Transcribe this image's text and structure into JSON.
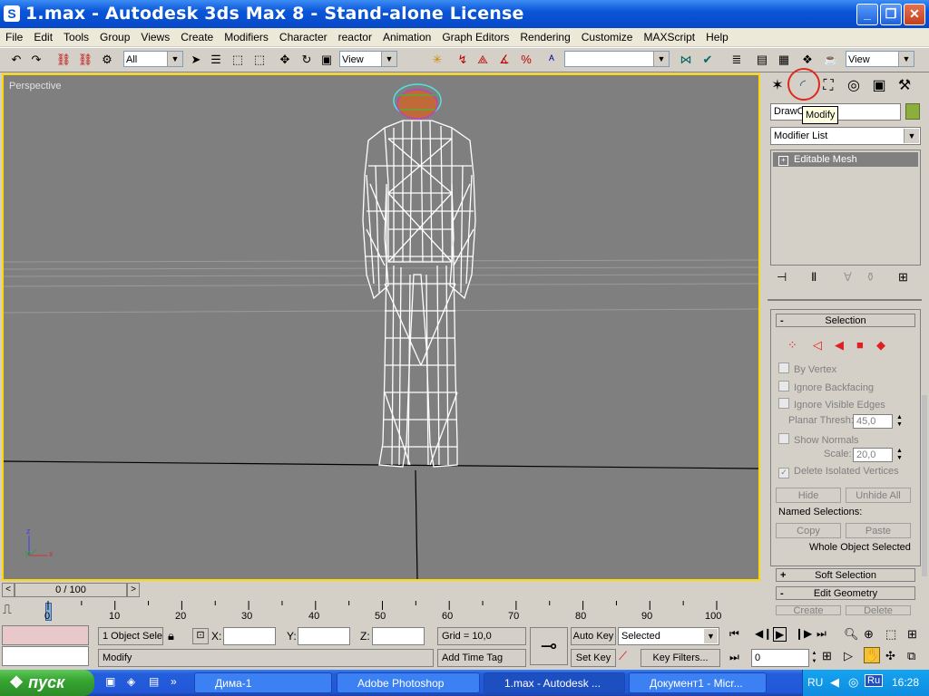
{
  "window": {
    "title": "1.max - Autodesk 3ds Max 8  - Stand-alone License",
    "icon_letter": "S",
    "minimize": "_",
    "maximize": "❐",
    "close": "✕"
  },
  "menu": [
    "File",
    "Edit",
    "Tools",
    "Group",
    "Views",
    "Create",
    "Modifiers",
    "Character",
    "reactor",
    "Animation",
    "Graph Editors",
    "Rendering",
    "Customize",
    "MAXScript",
    "Help"
  ],
  "toolbar": {
    "selection_filter": "All",
    "reference_coord": "View",
    "named_selection": "",
    "view_dropdown": "View"
  },
  "viewport": {
    "label": "Perspective",
    "axis_x": "x",
    "axis_y": "y",
    "axis_z": "z"
  },
  "command_panel": {
    "tooltip": "Modify",
    "object_name": "DrawC",
    "object_color": "#8caf3c",
    "modifier_list": "Modifier List",
    "stack_items": [
      {
        "label": "Editable Mesh",
        "expand": "+"
      }
    ],
    "rollouts": {
      "selection": {
        "title": "Selection",
        "toggle": "-",
        "by_vertex": "By Vertex",
        "ignore_backfacing": "Ignore Backfacing",
        "ignore_visible_edges": "Ignore Visible Edges",
        "planar_thresh_label": "Planar Thresh:",
        "planar_thresh_value": "45,0",
        "show_normals": "Show Normals",
        "scale_label": "Scale:",
        "scale_value": "20,0",
        "delete_isolated": "Delete Isolated Vertices",
        "hide": "Hide",
        "unhide_all": "Unhide All",
        "named_selections": "Named Selections:",
        "copy": "Copy",
        "paste": "Paste",
        "status": "Whole Object Selected"
      },
      "soft_selection": {
        "title": "Soft Selection",
        "toggle": "+"
      },
      "edit_geometry": {
        "title": "Edit Geometry",
        "toggle": "-",
        "create": "Create",
        "delete": "Delete"
      }
    }
  },
  "timeline": {
    "slider": "0 / 100",
    "prev": "<",
    "next": ">",
    "ticks": [
      "0",
      "10",
      "20",
      "30",
      "40",
      "50",
      "60",
      "70",
      "80",
      "90",
      "100"
    ]
  },
  "status": {
    "selection": "1 Object Sele",
    "x_label": "X:",
    "y_label": "Y:",
    "z_label": "Z:",
    "grid": "Grid = 10,0",
    "add_time_tag": "Add Time Tag",
    "prompt": "Modify",
    "auto_key": "Auto Key",
    "set_key": "Set Key",
    "key_mode": "Selected",
    "key_filters": "Key Filters...",
    "frame": "0"
  },
  "taskbar": {
    "start": "пуск",
    "tasks": [
      "Дима-1",
      "Adobe Photoshop",
      "1.max - Autodesk ...",
      "Документ1 - Micr..."
    ],
    "lang": "RU",
    "clock": "16:28"
  }
}
